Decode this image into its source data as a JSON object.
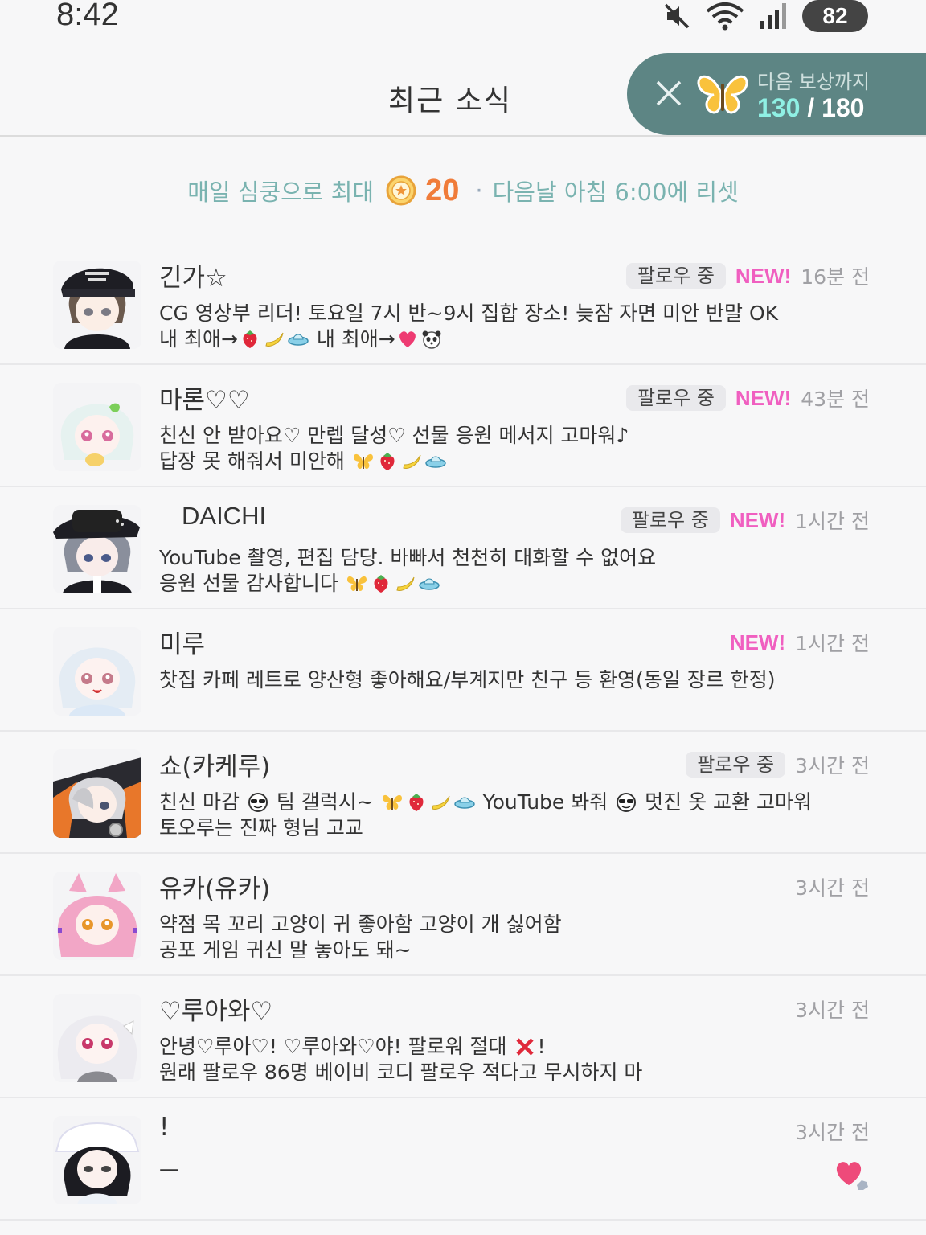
{
  "status_bar": {
    "time": "8:42",
    "battery": "82"
  },
  "header": {
    "title": "최근 소식",
    "reward": {
      "label": "다음 보상까지",
      "current": "130",
      "separator": " / ",
      "total": "180"
    }
  },
  "daily": {
    "prefix": "매일 심쿵으로 최대",
    "count": "20",
    "dot": "·",
    "suffix": "다음날 아침 6:00에 리셋"
  },
  "feed": [
    {
      "name": "긴가☆",
      "follow": "팔로우 중",
      "new": "NEW!",
      "time": "16분 전",
      "line1": "CG 영상부 리더! 토요일 7시 반~9시 집합 장소! 늦잠 자면 미안 반말 OK",
      "line2a": "내 최애→",
      "line2b": " 내 최애→"
    },
    {
      "name": "마론♡♡",
      "follow": "팔로우 중",
      "new": "NEW!",
      "time": "43분 전",
      "line1": "친신 안 받아요♡ 만렙 달성♡ 선물 응원 메서지 고마워♪",
      "line2a": "답장 못 해줘서 미안해 "
    },
    {
      "name": "DAICHI",
      "follow": "팔로우 중",
      "new": "NEW!",
      "time": "1시간 전",
      "line1": "YouTube 촬영, 편집 담당. 바빠서 천천히 대화할 수 없어요",
      "line2a": "응원 선물 감사합니다 "
    },
    {
      "name": "미루",
      "new": "NEW!",
      "time": "1시간 전",
      "line1": "찻집 카페 레트로 양산형 좋아해요/부계지만 친구 등 환영(동일 장르 한정)"
    },
    {
      "name": "쇼(카케루)",
      "follow": "팔로우 중",
      "time": "3시간 전",
      "line1a": "친신 마감 ",
      "line1b": " 팀 갤럭시~ ",
      "line1c": " YouTube 봐줘 ",
      "line1d": " 멋진 옷 교환 고마워",
      "line2a": "토오루는 진짜 형님 고교"
    },
    {
      "name": "유카(유카)",
      "time": "3시간 전",
      "line1": "약점 목 꼬리 고양이 귀 좋아함 고양이 개 싫어함",
      "line2a": "공포 게임 귀신 말 놓아도 돼~"
    },
    {
      "name": "♡루아와♡",
      "time": "3시간 전",
      "line1a": "안녕♡루아♡! ♡루아와♡야! 팔로워 절대 ",
      "line1b": "!",
      "line2a": "원래 팔로우 86명 베이비 코디 팔로우 적다고 무시하지 마"
    },
    {
      "name": "!",
      "time": "3시간 전",
      "line1": "—"
    }
  ],
  "colors": {
    "accent_teal": "#5d8584",
    "new_pink": "#f05fc0",
    "coin_orange": "#f07c3a"
  },
  "icons": [
    "mute-icon",
    "wifi-icon",
    "signal-icon",
    "battery-icon",
    "close-icon",
    "butterfly-icon",
    "coin-icon",
    "heart-reaction-icon"
  ]
}
